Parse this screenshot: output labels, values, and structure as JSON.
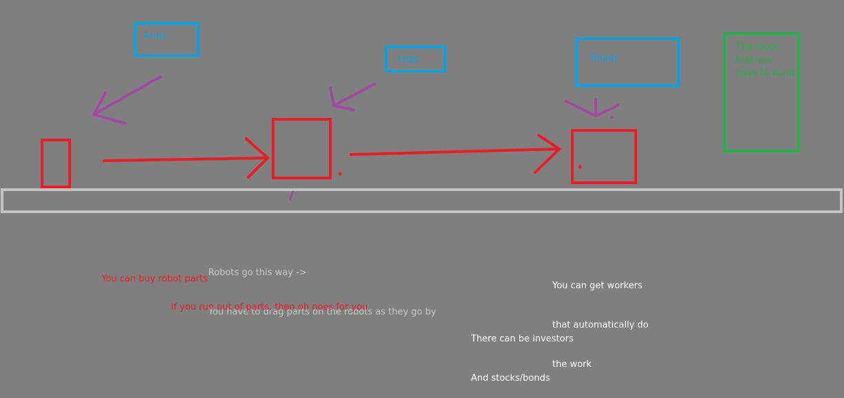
{
  "part_boxes": {
    "arms": "Arms",
    "legs": "Legs",
    "heads": "Heads",
    "target_robot": [
      "The robot",
      "that you",
      "have to build"
    ]
  },
  "notes": {
    "direction": [
      "Robots go this way ->",
      "You have to drag parts on the robots as they go by"
    ],
    "buy_parts": "You can buy robot parts",
    "out_of_parts": "If you run out of parts, then oh noes for you",
    "workers": [
      "You can get workers",
      "that automatically do",
      "the work"
    ],
    "investors": [
      "There can be investors",
      "And stocks/bonds"
    ]
  },
  "colors": {
    "background": "#7f7f7f",
    "robot_red": "#ed1c24",
    "part_box_blue": "#00a2e8",
    "drag_arrow_purple": "#a349a4",
    "target_green": "#22b14c",
    "conveyor": "#c3c3c3",
    "note_gray": "#c8c8c8",
    "note_white": "#ffffff"
  }
}
